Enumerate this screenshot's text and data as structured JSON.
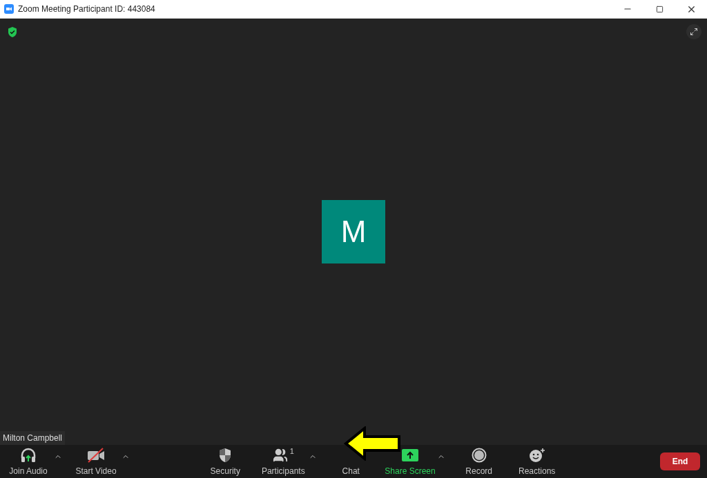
{
  "window": {
    "title": "Zoom Meeting Participant ID: 443084"
  },
  "video": {
    "avatar_initial": "M",
    "name_tag": "Milton Campbell"
  },
  "toolbar": {
    "left": [
      {
        "label": "Join Audio",
        "kind": "audio",
        "caret": true
      },
      {
        "label": "Start Video",
        "kind": "video",
        "caret": true
      }
    ],
    "center": [
      {
        "label": "Security",
        "kind": "security",
        "caret": false
      },
      {
        "label": "Participants",
        "kind": "participants",
        "count": "1",
        "caret": true
      },
      {
        "label": "Chat",
        "kind": "chat",
        "caret": false
      },
      {
        "label": "Share Screen",
        "kind": "share",
        "caret": true
      },
      {
        "label": "Record",
        "kind": "record",
        "caret": false
      },
      {
        "label": "Reactions",
        "kind": "reactions",
        "caret": false
      }
    ],
    "end_button": "End"
  }
}
